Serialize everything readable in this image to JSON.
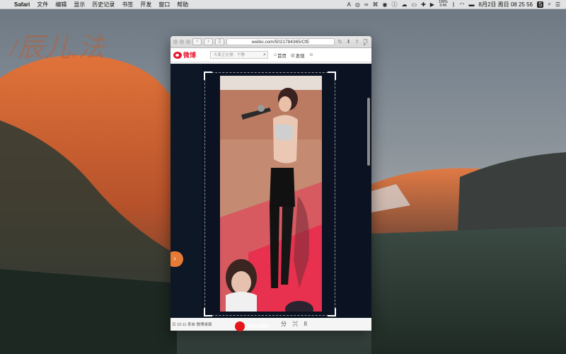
{
  "menubar": {
    "apple": "",
    "app": "Safari",
    "menus": [
      "文件",
      "编辑",
      "显示",
      "历史记录",
      "书签",
      "开发",
      "窗口",
      "帮助"
    ],
    "battery_pct": "100%",
    "battery_time": "0:49",
    "clock": "8月2日 周日  08 25 56",
    "s_icon": "S"
  },
  "safari": {
    "url": "weibo.com/5021784365/CfE",
    "nav_back": "‹",
    "nav_forward": "›",
    "reload": "↻",
    "new_tab": "+"
  },
  "weibo": {
    "logo": "微博",
    "search_placeholder": "大家正在搜：宁静",
    "nav_home": "首页",
    "nav_discover": "发现",
    "footer_time": "日 15:11 来自 微博桌面",
    "share_icons": "分 ⌘ 8"
  },
  "recorder": {
    "label": "RECORD"
  },
  "colors": {
    "record": "#e8141c",
    "weibo_red": "#e6162d",
    "arrow_orange": "#e77b35"
  }
}
